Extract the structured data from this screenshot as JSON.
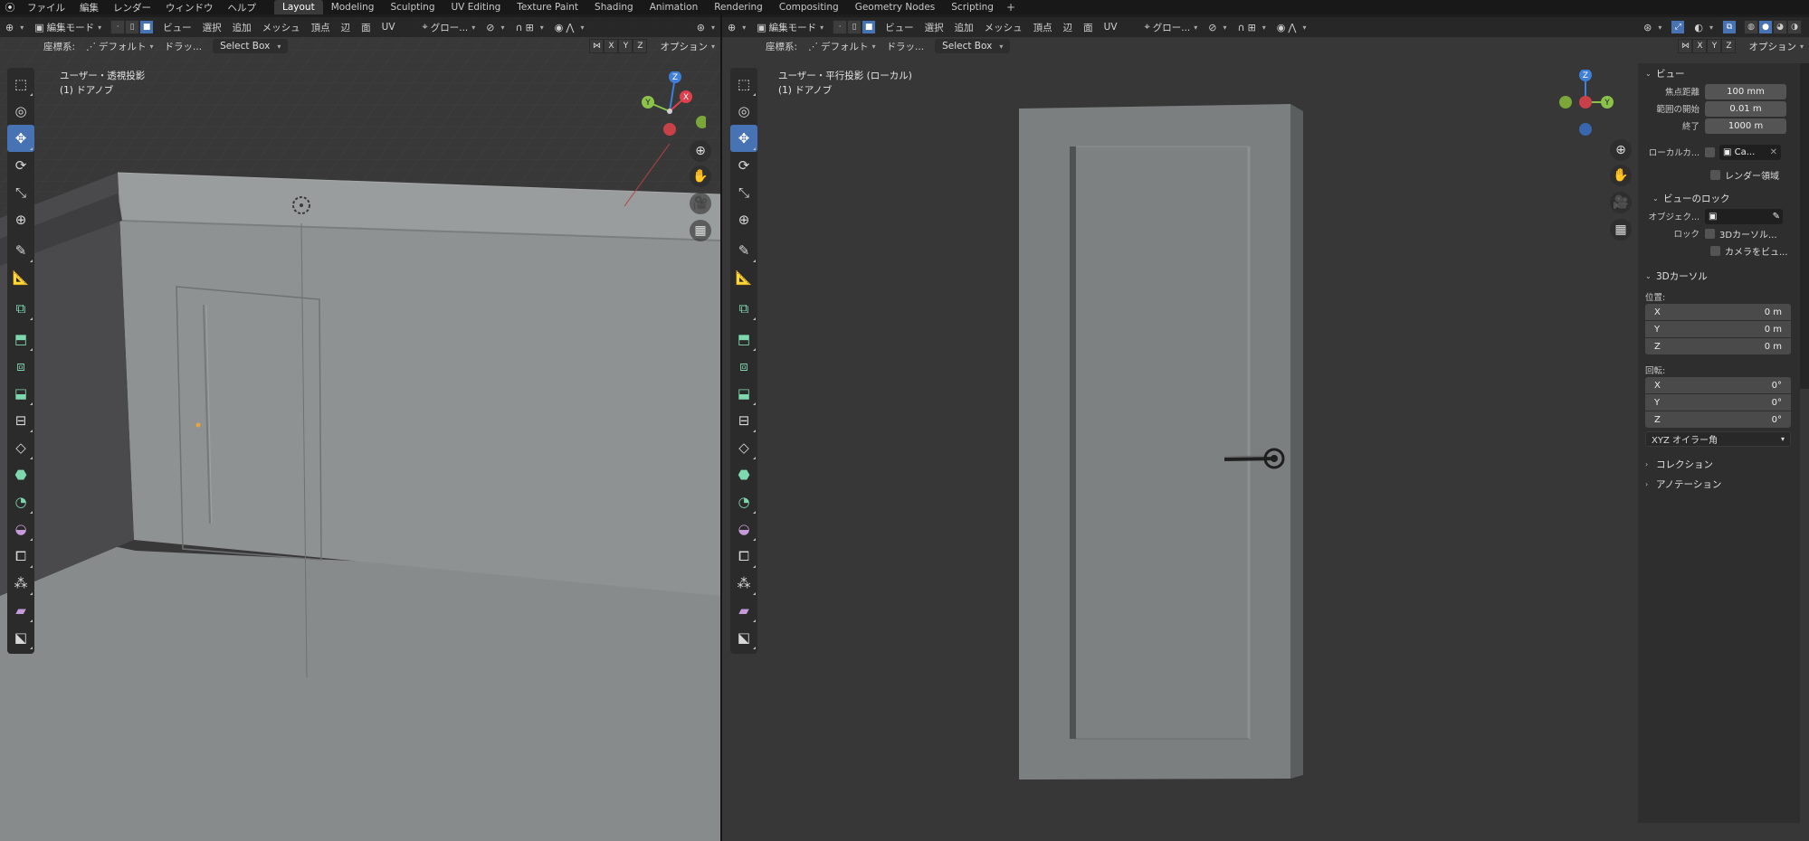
{
  "topbar": {
    "menus": [
      "ファイル",
      "編集",
      "レンダー",
      "ウィンドウ",
      "ヘルプ"
    ],
    "workspaces": [
      "Layout",
      "Modeling",
      "Sculpting",
      "UV Editing",
      "Texture Paint",
      "Shading",
      "Animation",
      "Rendering",
      "Compositing",
      "Geometry Nodes",
      "Scripting"
    ],
    "active_workspace": "Layout",
    "add_label": "+"
  },
  "viewport_header": {
    "mode": "編集モード",
    "menus": [
      "ビュー",
      "選択",
      "追加",
      "メッシュ",
      "頂点",
      "辺",
      "面",
      "UV"
    ],
    "transform_orientation": "グロー...",
    "coord_label": "座標系:",
    "pivot": "デフォルト",
    "drag_label": "ドラッ...",
    "select_box": "Select Box",
    "axis_x": "X",
    "axis_y": "Y",
    "axis_z": "Z",
    "options": "オプション"
  },
  "left_view": {
    "title": "ユーザー・透視投影",
    "object": "(1) ドアノブ"
  },
  "right_view": {
    "title": "ユーザー・平行投影 (ローカル)",
    "object": "(1) ドアノブ"
  },
  "gizmo": {
    "x": "X",
    "y": "Y",
    "z": "Z"
  },
  "npanel": {
    "view_section": "ビュー",
    "focal_label": "焦点距離",
    "focal_value": "100 mm",
    "clip_start_label": "範囲の開始",
    "clip_start_value": "0.01 m",
    "clip_end_label": "終了",
    "clip_end_value": "1000 m",
    "local_camera_label": "ローカルカ...",
    "local_camera_value": "Ca...",
    "render_region": "レンダー領域",
    "view_lock_section": "ビューのロック",
    "lock_object_label": "オブジェク...",
    "lock_label": "ロック",
    "lock_cursor": "3Dカーソル...",
    "lock_camera": "カメラをビュ...",
    "cursor_section": "3Dカーソル",
    "location_label": "位置:",
    "location": [
      {
        "axis": "X",
        "value": "0 m"
      },
      {
        "axis": "Y",
        "value": "0 m"
      },
      {
        "axis": "Z",
        "value": "0 m"
      }
    ],
    "rotation_label": "回転:",
    "rotation": [
      {
        "axis": "X",
        "value": "0°"
      },
      {
        "axis": "Y",
        "value": "0°"
      },
      {
        "axis": "Z",
        "value": "0°"
      }
    ],
    "rotation_mode": "XYZ オイラー角",
    "collection_section": "コレクション",
    "annotation_section": "アノテーション"
  },
  "colors": {
    "accent": "#4772b3",
    "axis_x": "#e0404d",
    "axis_y": "#8bc34a",
    "axis_z": "#3f7fd8"
  }
}
